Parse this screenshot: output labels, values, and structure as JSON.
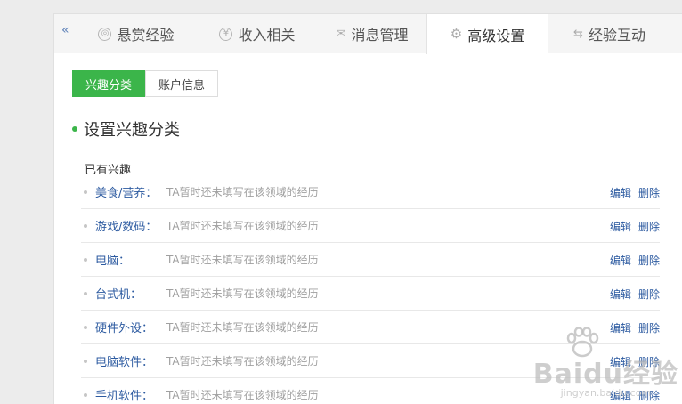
{
  "tabs": [
    {
      "label": "悬赏经验",
      "icon": "coin-icon"
    },
    {
      "label": "收入相关",
      "icon": "yen-icon"
    },
    {
      "label": "消息管理",
      "icon": "mail-icon"
    },
    {
      "label": "高级设置",
      "icon": "gear-icon"
    },
    {
      "label": "经验互动",
      "icon": "exchange-icon"
    }
  ],
  "active_tab": "高级设置",
  "subtabs": [
    {
      "label": "兴趣分类"
    },
    {
      "label": "账户信息"
    }
  ],
  "section_title": "设置兴趣分类",
  "existing_label": "已有兴趣",
  "interests": [
    {
      "name": "美食/营养：",
      "desc": "TA暂时还未填写在该领域的经历"
    },
    {
      "name": "游戏/数码：",
      "desc": "TA暂时还未填写在该领域的经历"
    },
    {
      "name": "电脑：",
      "desc": "TA暂时还未填写在该领域的经历"
    },
    {
      "name": "台式机：",
      "desc": "TA暂时还未填写在该领域的经历"
    },
    {
      "name": "硬件外设：",
      "desc": "TA暂时还未填写在该领域的经历"
    },
    {
      "name": "电脑软件：",
      "desc": "TA暂时还未填写在该领域的经历"
    },
    {
      "name": "手机软件：",
      "desc": "TA暂时还未填写在该领域的经历"
    }
  ],
  "actions": {
    "edit": "编辑",
    "delete": "删除"
  },
  "watermark": {
    "brand": "Baidu经验",
    "site": "jingyan.baidu.com"
  },
  "colors": {
    "accent_green": "#3bb54a",
    "link_blue": "#2c5aa0"
  }
}
